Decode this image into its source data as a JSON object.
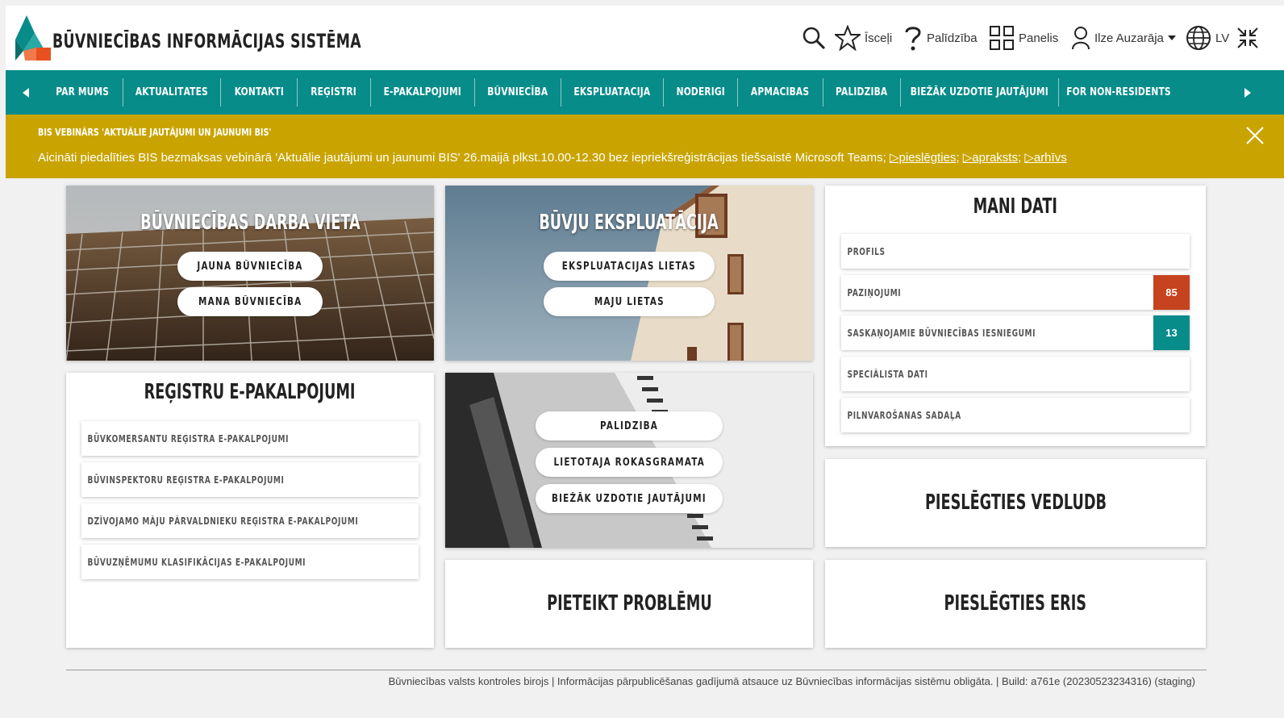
{
  "header": {
    "logo_text": "BŪVNIECĪBAS INFORMĀCIJAS SISTĒMA",
    "favorites_label": "Īsceļi",
    "help_label": "Palīdzība",
    "panel_label": "Panelis",
    "user_name": "Ilze Auzarāja",
    "language": "LV",
    "colors": {
      "teal": "#078c8a",
      "orange": "#e8501f",
      "banner": "#c9a400"
    }
  },
  "nav": {
    "items": [
      "PAR MUMS",
      "AKTUALITĀTES",
      "KONTAKTI",
      "REĢISTRI",
      "E-PAKALPOJUMI",
      "BŪVNIECĪBA",
      "EKSPLUATĀCIJA",
      "NODERĪGI",
      "APMĀCĪBAS",
      "PALĪDZĪBA",
      "BIEŽĀK UZDOTIE JAUTĀJUMI",
      "FOR NON-RESIDENTS"
    ]
  },
  "banner": {
    "title": "BIS VEBINĀRS 'AKTUĀLIE JAUTĀJUMI UN JAUNUMI BIS'",
    "text": "Aicināti piedalīties BIS bezmaksas vebinārā 'Aktuālie jautājumi un jaunumi BIS' 26.maijā plkst.10.00-12.30 bez iepriekšreģistrācijas tiešsaistē Microsoft Teams;",
    "link1": "▷pieslēgties",
    "link2": "▷apraksts",
    "link3": "▷arhīvs"
  },
  "cards": {
    "workplace": {
      "title": "BŪVNIECĪBAS DARBA VIETA",
      "btn1": "JAUNA BŪVNIECĪBA",
      "btn2": "MANA BŪVNIECĪBA"
    },
    "exploitation": {
      "title": "BŪVJU EKSPLUATĀCIJA",
      "btn1": "EKSPLUATĀCIJAS LIETAS",
      "btn2": "MĀJU LIETAS"
    },
    "my_data": {
      "title": "MANI DATI",
      "items": [
        {
          "label": "PROFILS",
          "badge": ""
        },
        {
          "label": "PAZIŅOJUMI",
          "badge": "85"
        },
        {
          "label": "SASKAŅOJAMIE BŪVNIECĪBAS IESNIEGUMI",
          "badge": "13"
        },
        {
          "label": "SPECIĀLISTA DATI",
          "badge": ""
        },
        {
          "label": "PILNVAROŠANAS SADAĻA",
          "badge": ""
        }
      ]
    },
    "registry": {
      "title": "REĢISTRU E-PAKALPOJUMI",
      "items": [
        "BŪVKOMERSANTU REĢISTRA E-PAKALPOJUMI",
        "BŪVINSPEKTORU REĢISTRA E-PAKALPOJUMI",
        "DZĪVOJAMO MĀJU PĀRVALDNIEKU REĢISTRA E-PAKALPOJUMI",
        "BŪVUZŅĒMUMU KLASIFIKĀCIJAS E-PAKALPOJUMI"
      ]
    },
    "help": {
      "btn1": "PALĪDZĪBA",
      "btn2": "LIETOTĀJA ROKASGRĀMATA",
      "btn3": "BIEŽĀK UZDOTIE JAUTĀJUMI"
    },
    "vedludb": {
      "title": "PIESLĒGTIES VEDLUDB"
    },
    "problem": {
      "title": "PIETEIKT PROBLĒMU"
    },
    "eris": {
      "title": "PIESLĒGTIES ERIS"
    }
  },
  "footer": {
    "text": "Būvniecības valsts kontroles birojs | Informācijas pārpublicēšanas gadījumā atsauce uz Būvniecības informācijas sistēmu obligāta. | Build: a761e (20230523234316) (staging)"
  }
}
